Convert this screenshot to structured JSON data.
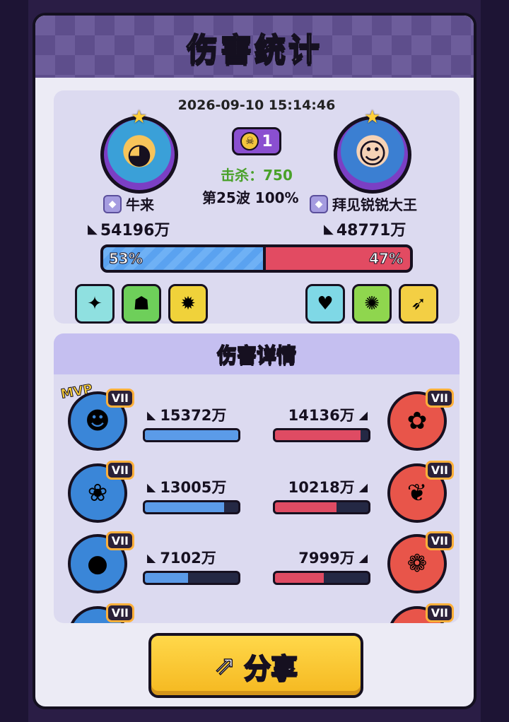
{
  "header": {
    "title": "伤害统计"
  },
  "summary": {
    "timestamp": "2026-09-10 15:14:46",
    "center_badge": "1",
    "kills": "击杀：750",
    "wave": "第25波 100%",
    "left": {
      "name": "牛来",
      "power": "54196万",
      "ratio": "53%",
      "ratio_value": 53
    },
    "right": {
      "name": "拜见锐锐大王",
      "power": "48771万",
      "ratio": "47%",
      "ratio_value": 47
    },
    "left_skills": [
      "bubble-skill-icon",
      "totem-skill-icon",
      "beast-skill-icon"
    ],
    "right_skills": [
      "heart-skill-icon",
      "gear-skill-icon",
      "crossbow-skill-icon"
    ]
  },
  "details": {
    "title": "伤害详情",
    "mvp": "MVP",
    "tier": "VII",
    "rows": [
      {
        "left_damage": "15372万",
        "right_damage": "14136万",
        "left_fill": 1.0,
        "right_fill": 0.92
      },
      {
        "left_damage": "13005万",
        "right_damage": "10218万",
        "left_fill": 0.85,
        "right_fill": 0.66
      },
      {
        "left_damage": "7102万",
        "right_damage": "7999万",
        "left_fill": 0.46,
        "right_fill": 0.52
      }
    ]
  },
  "share": {
    "label": "分享"
  },
  "colors": {
    "blue": "#5b9be8",
    "red": "#df4b63",
    "accent": "#f5b820"
  }
}
